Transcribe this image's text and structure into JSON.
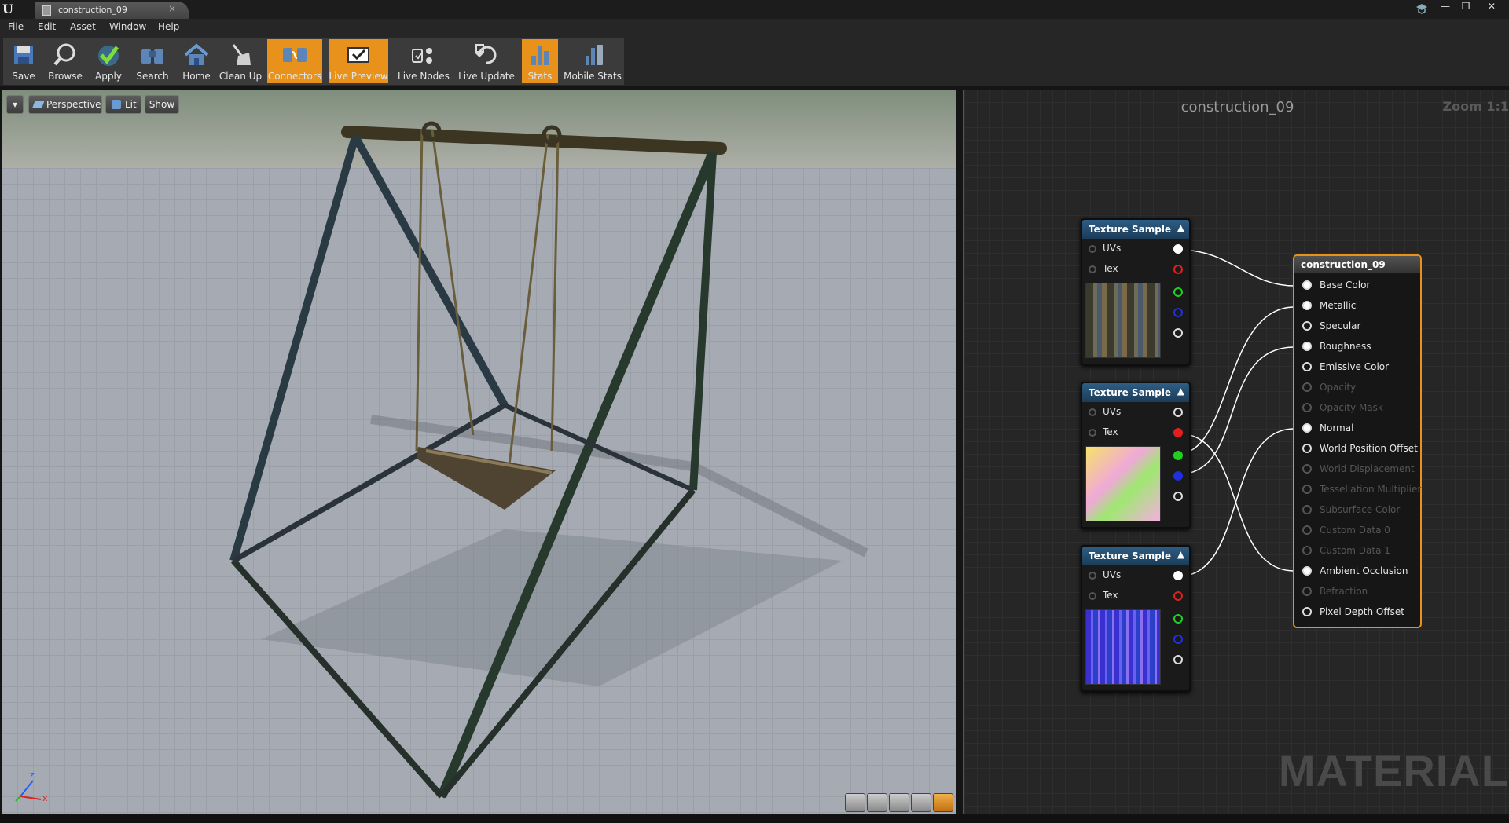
{
  "window": {
    "tab_title": "construction_09",
    "controls": [
      "—",
      "❐",
      "✕"
    ]
  },
  "menu": [
    "File",
    "Edit",
    "Asset",
    "Window",
    "Help"
  ],
  "toolbar": [
    {
      "label": "Save",
      "icon": "save-icon",
      "active": false
    },
    {
      "label": "Browse",
      "icon": "browse-icon",
      "active": false
    },
    {
      "label": "Apply",
      "icon": "apply-icon",
      "active": false
    },
    {
      "label": "Search",
      "icon": "search-icon",
      "active": false
    },
    {
      "label": "Home",
      "icon": "home-icon",
      "active": false
    },
    {
      "label": "Clean Up",
      "icon": "clean-up-icon",
      "active": false
    },
    {
      "label": "Connectors",
      "icon": "connectors-icon",
      "active": true
    },
    {
      "label": "Live Preview",
      "icon": "live-preview-icon",
      "active": true
    },
    {
      "label": "Live Nodes",
      "icon": "live-nodes-icon",
      "active": false
    },
    {
      "label": "Live Update",
      "icon": "live-update-icon",
      "active": false
    },
    {
      "label": "Stats",
      "icon": "stats-icon",
      "active": true
    },
    {
      "label": "Mobile Stats",
      "icon": "mobile-stats-icon",
      "active": false
    }
  ],
  "viewport": {
    "perspective_label": "Perspective",
    "lit_label": "Lit",
    "show_label": "Show",
    "axis_z": "z",
    "axis_x": "x"
  },
  "graph": {
    "title": "construction_09",
    "zoom": "Zoom 1:1",
    "watermark": "MATERIAL",
    "texture_nodes": [
      {
        "title": "Texture Sample",
        "uv_label": "UVs",
        "tex_label": "Tex",
        "preview": "diffuse"
      },
      {
        "title": "Texture Sample",
        "uv_label": "UVs",
        "tex_label": "Tex",
        "preview": "masks"
      },
      {
        "title": "Texture Sample",
        "uv_label": "UVs",
        "tex_label": "Tex",
        "preview": "normal"
      }
    ],
    "material_node": {
      "title": "construction_09",
      "inputs": [
        {
          "label": "Base Color",
          "enabled": true,
          "connected": true
        },
        {
          "label": "Metallic",
          "enabled": true,
          "connected": true
        },
        {
          "label": "Specular",
          "enabled": true,
          "connected": false
        },
        {
          "label": "Roughness",
          "enabled": true,
          "connected": true
        },
        {
          "label": "Emissive Color",
          "enabled": true,
          "connected": false
        },
        {
          "label": "Opacity",
          "enabled": false,
          "connected": false
        },
        {
          "label": "Opacity Mask",
          "enabled": false,
          "connected": false
        },
        {
          "label": "Normal",
          "enabled": true,
          "connected": true
        },
        {
          "label": "World Position Offset",
          "enabled": true,
          "connected": false
        },
        {
          "label": "World Displacement",
          "enabled": false,
          "connected": false
        },
        {
          "label": "Tessellation Multiplier",
          "enabled": false,
          "connected": false
        },
        {
          "label": "Subsurface Color",
          "enabled": false,
          "connected": false
        },
        {
          "label": "Custom Data 0",
          "enabled": false,
          "connected": false
        },
        {
          "label": "Custom Data 1",
          "enabled": false,
          "connected": false
        },
        {
          "label": "Ambient Occlusion",
          "enabled": true,
          "connected": true
        },
        {
          "label": "Refraction",
          "enabled": false,
          "connected": false
        },
        {
          "label": "Pixel Depth Offset",
          "enabled": true,
          "connected": false
        }
      ]
    }
  },
  "colors": {
    "accent": "#e8921c",
    "node_header": "#2e5d84",
    "pin_red": "#e02020",
    "pin_green": "#20d020",
    "pin_blue": "#2030e0"
  }
}
